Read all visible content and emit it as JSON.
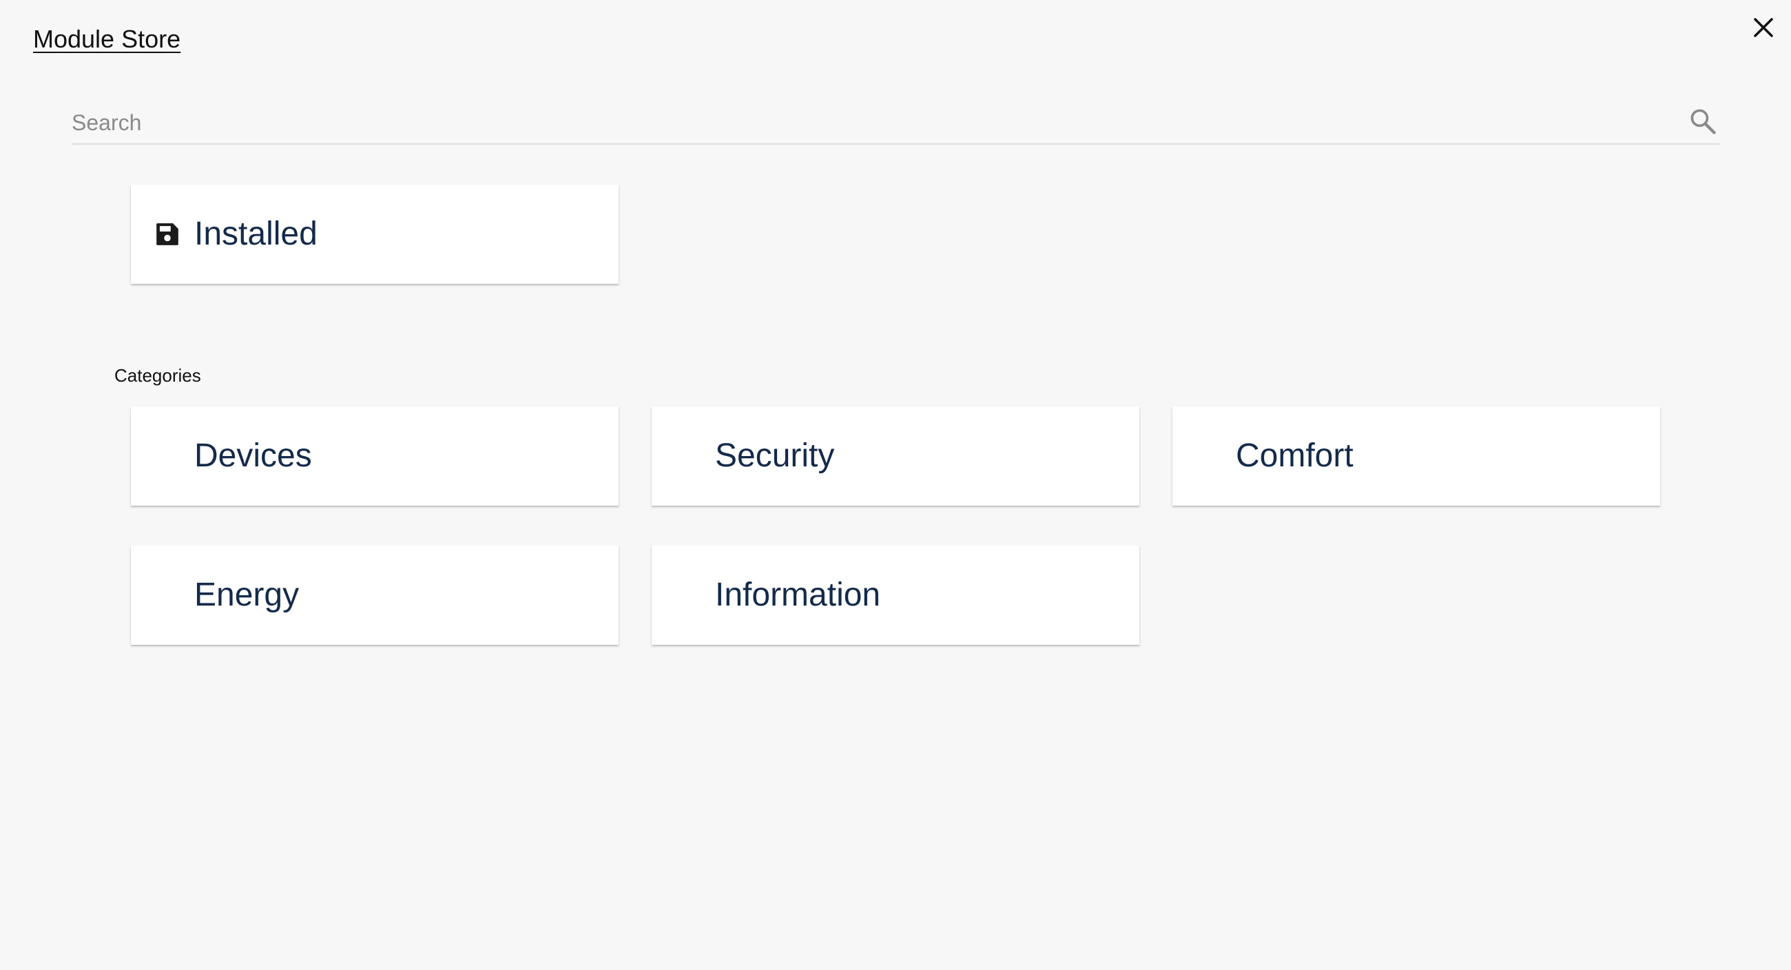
{
  "header": {
    "title": "Module Store",
    "close_icon": "close-icon"
  },
  "search": {
    "placeholder": "Search",
    "value": "",
    "icon": "search-icon"
  },
  "installed": {
    "label": "Installed",
    "icon": "save-icon"
  },
  "categories": {
    "heading": "Categories",
    "items": [
      {
        "label": "Devices"
      },
      {
        "label": "Security"
      },
      {
        "label": "Comfort"
      },
      {
        "label": "Energy"
      },
      {
        "label": "Information"
      }
    ]
  },
  "colors": {
    "background": "#f7f7f7",
    "card_text": "#142a4a",
    "card_background": "#ffffff"
  }
}
